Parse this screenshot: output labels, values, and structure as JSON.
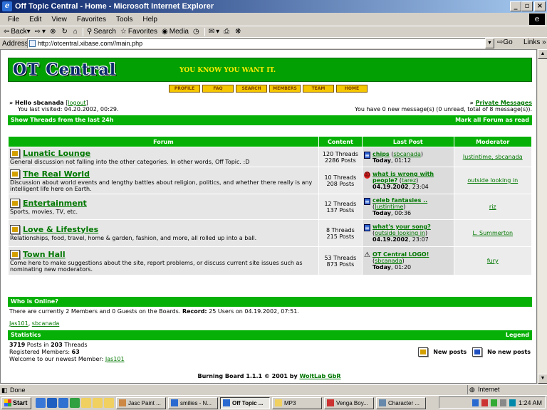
{
  "window": {
    "title": "Off Topic Central - Home - Microsoft Internet Explorer"
  },
  "menu": [
    "File",
    "Edit",
    "View",
    "Favorites",
    "Tools",
    "Help"
  ],
  "toolbar": {
    "back": "Back",
    "forward": "",
    "search": "Search",
    "favorites": "Favorites",
    "media": "Media"
  },
  "address": {
    "label": "Address",
    "url": "http://otcentral.xibase.com//main.php",
    "go": "Go",
    "links": "Links"
  },
  "site": {
    "logo": "OT Central",
    "slogan": "YOU KNOW YOU WANT IT.",
    "nav": [
      "PROFILE",
      "FAQ",
      "SEARCH",
      "MEMBERS",
      "TEAM",
      "HOME"
    ]
  },
  "user": {
    "hello_prefix": "» Hello ",
    "name": "sbcanada",
    "logout": "logout",
    "last_visited": "You last visited: 04.20.2002, 00:29.",
    "pm_link": "Private Messages",
    "pm_prefix": "» ",
    "pm_text": "You have 0 new message(s) (0 unread, total of 8 message(s))."
  },
  "bars": {
    "show_threads": "Show Threads from the last 24h",
    "mark_read": "Mark all Forum as read",
    "who_online": "Who is Online?",
    "statistics": "Statistics",
    "legend": "Legend"
  },
  "forum_table": {
    "headers": [
      "Forum",
      "Content",
      "Last Post",
      "Moderator"
    ],
    "rows": [
      {
        "name": "Lunatic Lounge",
        "desc": "General discussion not falling into the other categories. In other words, Off Topic. :D",
        "threads": "120 Threads",
        "posts": "2286 Posts",
        "lp_title": "chips",
        "lp_user": "sbcanada",
        "lp_date": "Today",
        "lp_time": ", 01:12",
        "lp_icon": "doc",
        "mod": "Justintime, sbcanada"
      },
      {
        "name": "The Real World",
        "desc": "Discussion about world events and lengthy battles about religion, politics, and whether there really is any intelligent life here on Earth.",
        "threads": "10 Threads",
        "posts": "208 Posts",
        "lp_title": "what is wrong with people?",
        "lp_user": "tarez",
        "lp_date": "04.19.2002",
        "lp_time": ", 23:04",
        "lp_icon": "sad",
        "mod": "outside looking in"
      },
      {
        "name": "Entertainment",
        "desc": "Sports, movies, TV, etc.",
        "threads": "12 Threads",
        "posts": "137 Posts",
        "lp_title": "celeb fantasies ..",
        "lp_user": "Justintime",
        "lp_date": "Today",
        "lp_time": ", 00:36",
        "lp_icon": "doc",
        "mod": "riz"
      },
      {
        "name": "Love & Lifestyles",
        "desc": "Relationships, food, travel, home & garden, fashion, and more, all rolled up into a ball.",
        "threads": "8 Threads",
        "posts": "215 Posts",
        "lp_title": "what's your song?",
        "lp_user": "outside looking in",
        "lp_date": "04.19.2002",
        "lp_time": ", 23:07",
        "lp_icon": "doc",
        "mod": "L. Summerton"
      },
      {
        "name": "Town Hall",
        "desc": "Come here to make suggestions about the site, report problems, or discuss current site issues such as nominating new moderators.",
        "threads": "53 Threads",
        "posts": "873 Posts",
        "lp_title": "OT Central LOGO!",
        "lp_user": "sbcanada",
        "lp_date": "Today",
        "lp_time": ", 01:20",
        "lp_icon": "warn",
        "mod": "fury"
      }
    ]
  },
  "online": {
    "text_a": "There are currently 2 Members and 0 Guests on the Boards. ",
    "record_label": "Record:",
    "text_b": " 25 Users on 04.19.2002, 07:51.",
    "users": [
      "Jas101",
      "sbcanada"
    ]
  },
  "stats": {
    "posts": "3719",
    "posts_in": " Posts in ",
    "threads": "203",
    "threads_label": " Threads",
    "members_label": "Registered Members: ",
    "members": "63",
    "welcome": "Welcome to our newest Member: ",
    "newest": "Jas101"
  },
  "legend": {
    "new": "New posts",
    "nonew": "No new posts"
  },
  "footer": {
    "text": "Burning Board 1.1.1 © 2001 by ",
    "link": "WoltLab GbR"
  },
  "status": {
    "text": "Done",
    "zone": "Internet"
  },
  "taskbar": {
    "start": "Start",
    "tasks": [
      "Jasc Paint ...",
      "smilies - N...",
      "Off Topic ...",
      "MP3",
      "Venga Boy...",
      "Character ..."
    ],
    "clock": "1:24 AM"
  },
  "colors": {
    "forum_green": "#07b007",
    "link_green": "#007700",
    "nav_gold": "#f6c700"
  }
}
